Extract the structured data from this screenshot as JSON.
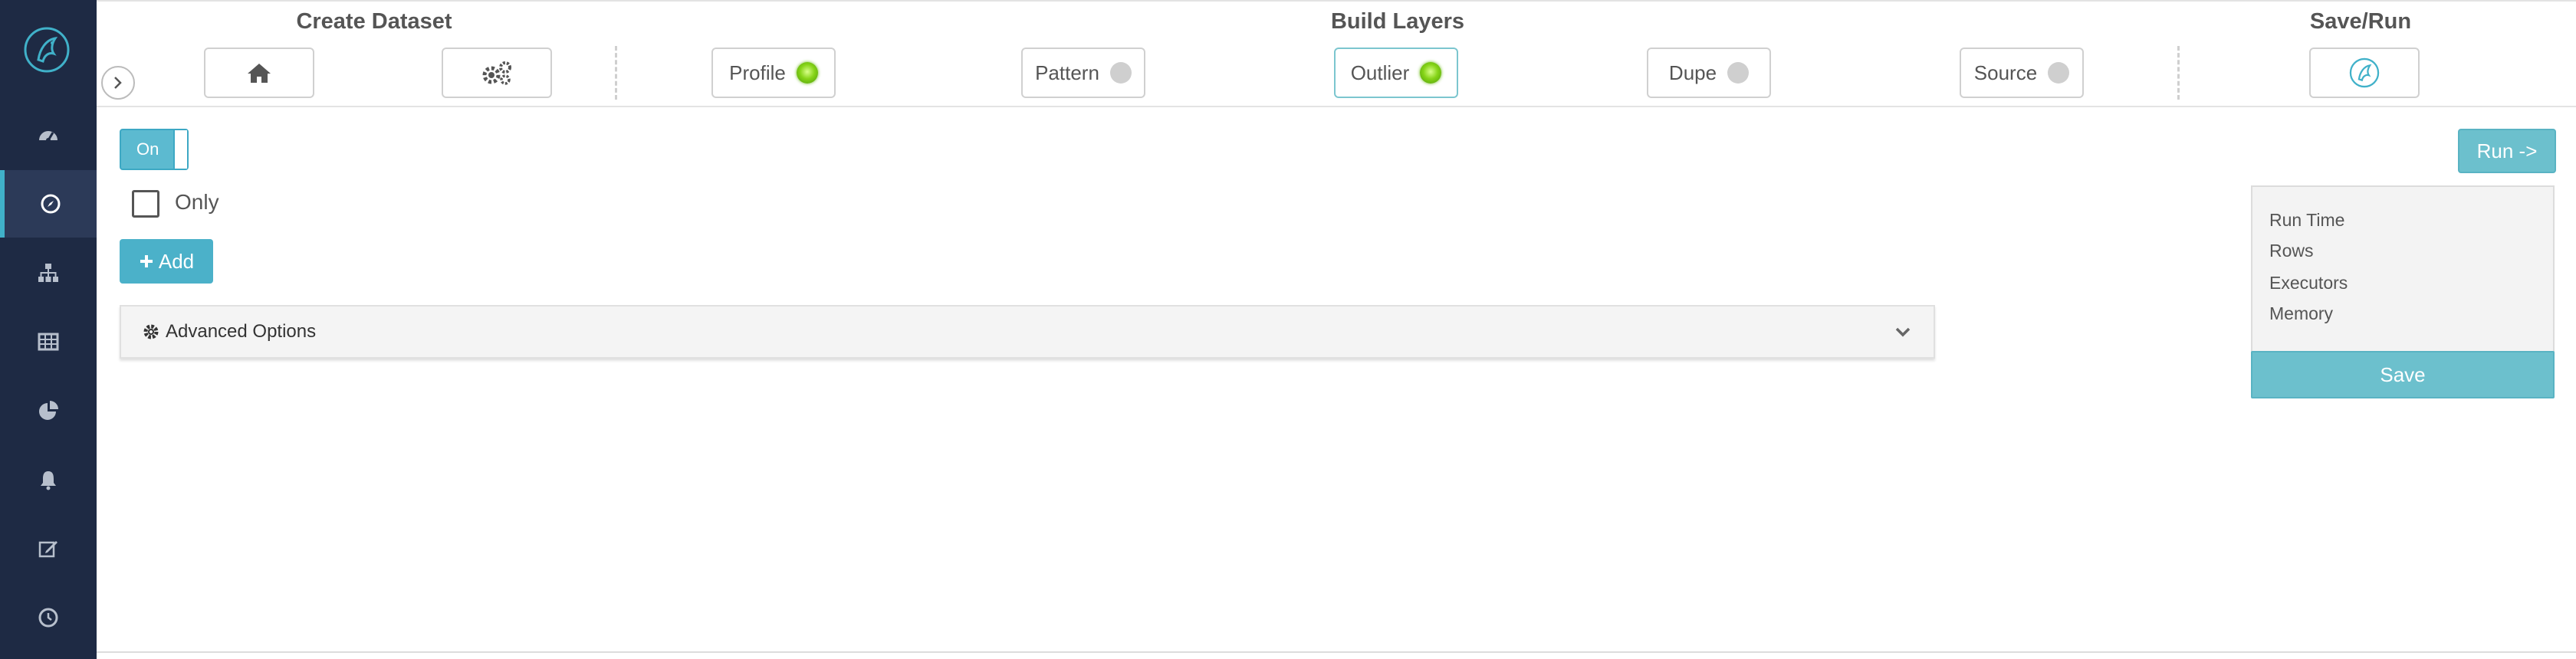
{
  "sections": {
    "create_dataset": "Create Dataset",
    "build_layers": "Build Layers",
    "save_run": "Save/Run"
  },
  "steps": [
    {
      "label": "Profile",
      "status": "on",
      "selected": false
    },
    {
      "label": "Pattern",
      "status": "off",
      "selected": false
    },
    {
      "label": "Outlier",
      "status": "on",
      "selected": true
    },
    {
      "label": "Dupe",
      "status": "off",
      "selected": false
    },
    {
      "label": "Source",
      "status": "off",
      "selected": false
    }
  ],
  "sidebar": {
    "items": [
      {
        "icon": "dashboard-icon"
      },
      {
        "icon": "compass-icon",
        "active": true
      },
      {
        "icon": "sitemap-icon"
      },
      {
        "icon": "table-icon"
      },
      {
        "icon": "pie-chart-icon"
      },
      {
        "icon": "bell-icon"
      },
      {
        "icon": "edit-icon"
      },
      {
        "icon": "clock-icon"
      }
    ]
  },
  "main": {
    "toggle_label": "On",
    "only_label": "Only",
    "add_label": "Add",
    "advanced_options_label": "Advanced Options"
  },
  "right_panel": {
    "run_label": "Run ->",
    "stats": [
      "Run Time",
      "Rows",
      "Executors",
      "Memory"
    ],
    "save_label": "Save"
  },
  "colors": {
    "sidebar": "#1e2a44",
    "accent": "#4bb1c9",
    "status_on": "#86d418",
    "status_off": "#cfcfcf"
  }
}
